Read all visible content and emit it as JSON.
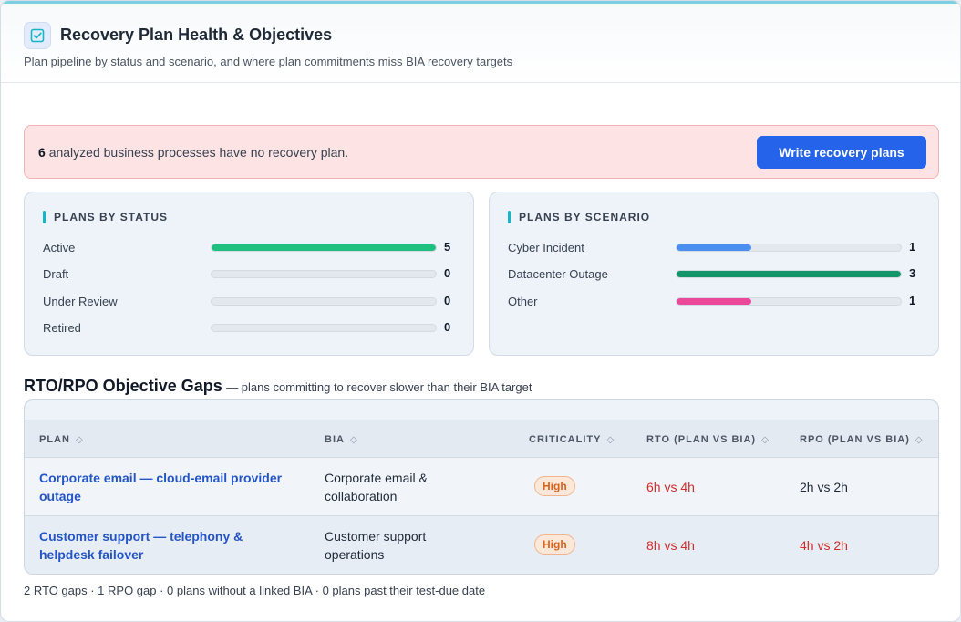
{
  "header": {
    "title": "Recovery Plan Health & Objectives",
    "subtitle": "Plan pipeline by status and scenario, and where plan commitments miss BIA recovery targets",
    "icon": "checklist-icon"
  },
  "alert": {
    "count": "6",
    "message": "analyzed business processes have no recovery plan.",
    "button_label": "Write recovery plans"
  },
  "plans_by_status": {
    "title": "PLANS BY STATUS",
    "max": 5,
    "items": [
      {
        "label": "Active",
        "count": "5",
        "value": 5,
        "color": "#1fbf7f"
      },
      {
        "label": "Draft",
        "count": "0",
        "value": 0,
        "color": "#1fbf7f"
      },
      {
        "label": "Under Review",
        "count": "0",
        "value": 0,
        "color": "#1fbf7f"
      },
      {
        "label": "Retired",
        "count": "0",
        "value": 0,
        "color": "#1fbf7f"
      }
    ]
  },
  "plans_by_scenario": {
    "title": "PLANS BY SCENARIO",
    "max": 3,
    "items": [
      {
        "label": "Cyber Incident",
        "count": "1",
        "value": 1,
        "color": "#4a8ef0"
      },
      {
        "label": "Datacenter Outage",
        "count": "3",
        "value": 3,
        "color": "#14966a"
      },
      {
        "label": "Other",
        "count": "1",
        "value": 1,
        "color": "#ec4899"
      }
    ]
  },
  "gaps": {
    "title": "RTO/RPO Objective Gaps",
    "note": "— plans committing to recover slower than their BIA target",
    "columns": [
      "PLAN",
      "BIA",
      "CRITICALITY",
      "RTO (PLAN VS BIA)",
      "RPO (PLAN VS BIA)"
    ],
    "rows": [
      {
        "plan_line1": "Corporate email — cloud-email provider",
        "plan_line2": "outage",
        "bia_line1": "Corporate email &",
        "bia_line2": "collaboration",
        "criticality": "High",
        "rto": "6h vs 4h",
        "rpo": "2h vs 2h"
      },
      {
        "plan_line1": "Customer support — telephony &",
        "plan_line2": "helpdesk failover",
        "bia_line1": "Customer support",
        "bia_line2": "operations",
        "criticality": "High",
        "rto": "8h vs 4h",
        "rpo": "4h vs 2h"
      }
    ],
    "footer": "2 RTO gaps · 1 RPO gap · 0 plans without a linked BIA · 0 plans past their test-due date"
  }
}
